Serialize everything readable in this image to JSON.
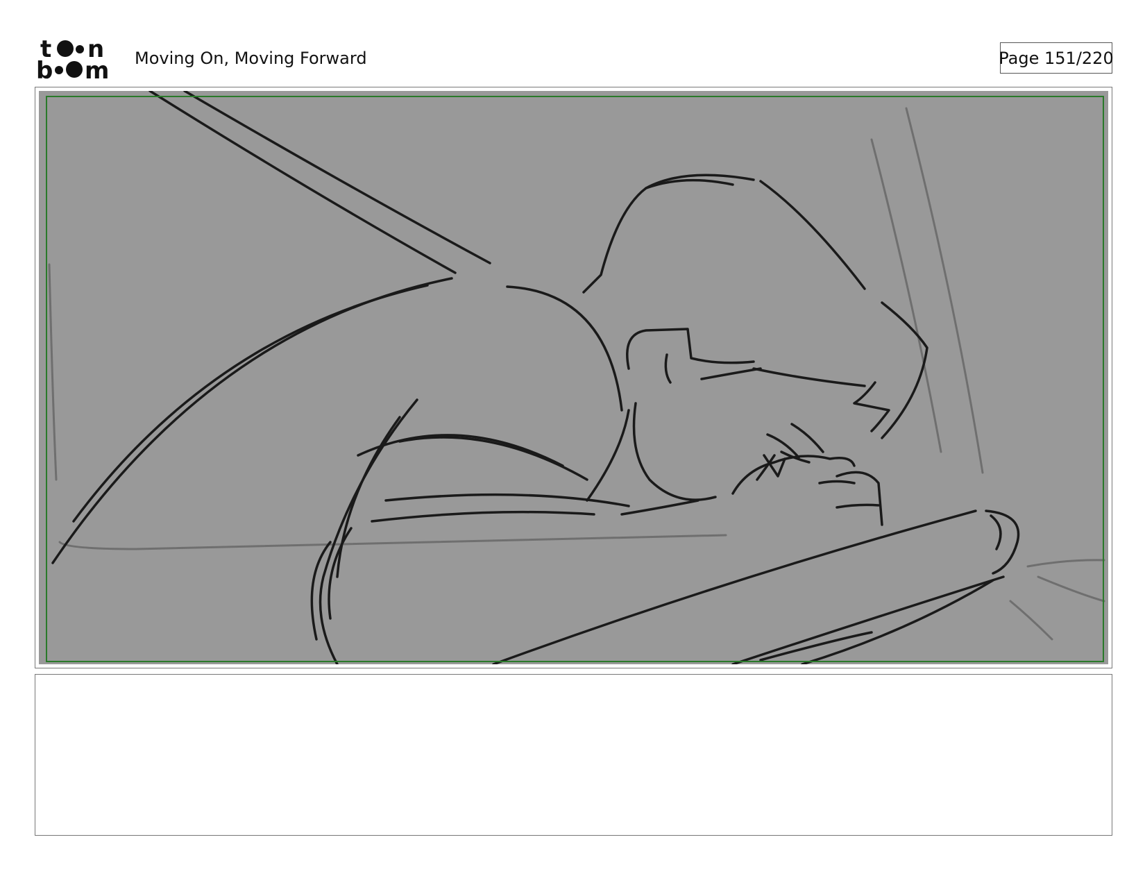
{
  "brand": {
    "logo_text": "toon boom"
  },
  "header": {
    "title": "Moving On, Moving Forward",
    "page_label": "Page 151/220"
  },
  "panel": {
    "notes_text": ""
  },
  "colors": {
    "panel_background": "#999999",
    "safe_frame": "#2a7a2a",
    "sketch_lines": "#1a1a1a"
  }
}
